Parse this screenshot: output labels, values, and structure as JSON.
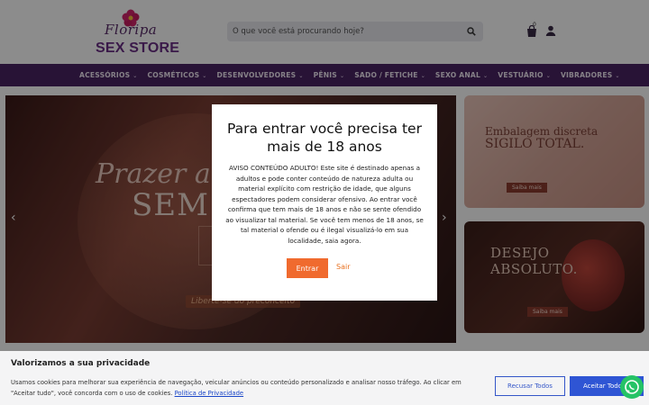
{
  "logo": {
    "script": "Floripa",
    "brand": "SEX STORE"
  },
  "search": {
    "placeholder": "O que você está procurando hoje?",
    "icon": "search-icon"
  },
  "header_icons": {
    "cart_icon": "shopping-bag-icon",
    "cart_count": "0",
    "user_icon": "user-icon"
  },
  "nav": {
    "items": [
      {
        "label": "ACESSÓRIOS"
      },
      {
        "label": "COSMÉTICOS"
      },
      {
        "label": "DESENVOLVEDORES"
      },
      {
        "label": "PÊNIS"
      },
      {
        "label": "SADO / FETICHE"
      },
      {
        "label": "SEXO ANAL"
      },
      {
        "label": "VESTUÁRIO"
      },
      {
        "label": "VIBRADORES"
      }
    ],
    "chevron": "⌄"
  },
  "hero": {
    "line1": "Prazer a",
    "line2": "SEM T",
    "tag": "Liberte-se do preconceito",
    "prev": "‹",
    "next": "›"
  },
  "side_banners": [
    {
      "line1": "Embalagem discreta",
      "line2": "SIGILO TOTAL.",
      "button": "Saiba mais"
    },
    {
      "line1": "DESEJO",
      "line2": "ABSOLUTO.",
      "button": "Saiba mais"
    }
  ],
  "age_modal": {
    "title": "Para entrar você precisa ter mais de 18 anos",
    "body": "AVISO CONTEÚDO ADULTO! Este site é destinado apenas a adultos e pode conter conteúdo de natureza adulta ou material explícito com restrição de idade, que alguns espectadores podem considerar ofensivo. Ao entrar você confirma que tem mais de 18 anos e não se sente ofendido ao visualizar tal material. Se você tem menos de 18 anos, se tal material o ofende ou é ilegal visualizá-lo em sua localidade, saia agora.",
    "enter_label": "Entrar",
    "leave_label": "Sair"
  },
  "cookie": {
    "title": "Valorizamos a sua privacidade",
    "text": "Usamos cookies para melhorar sua experiência de navegação, veicular anúncios ou conteúdo personalizado e analisar nosso tráfego. Ao clicar em \"Aceitar tudo\", você concorda com o uso de cookies.",
    "policy_link": "Política de Privacidade",
    "reject_label": "Recusar Todos",
    "accept_label": "Aceitar Todos"
  },
  "floating": {
    "whatsapp_icon": "whatsapp-icon"
  },
  "colors": {
    "nav_bg": "#4a2463",
    "accent_orange": "#f06a2e",
    "accept_blue": "#2f55d4",
    "whatsapp_green": "#25c366"
  }
}
